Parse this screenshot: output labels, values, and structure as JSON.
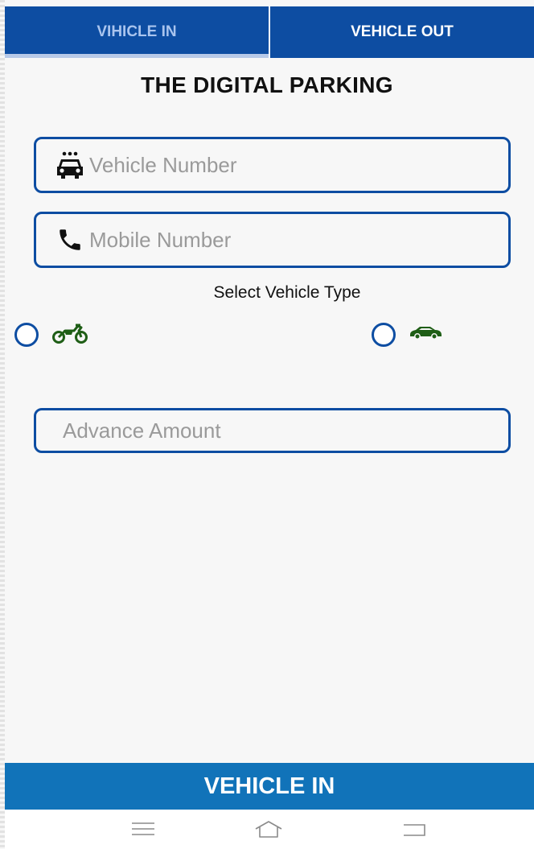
{
  "tabs": [
    {
      "label": "VIHICLE IN",
      "active": true
    },
    {
      "label": "VEHICLE OUT",
      "active": false
    }
  ],
  "title": "THE DIGITAL PARKING",
  "form": {
    "vehicle_number": {
      "placeholder": "Vehicle Number",
      "value": "",
      "icon": "car-front-icon"
    },
    "mobile_number": {
      "placeholder": "Mobile Number",
      "value": "",
      "icon": "phone-icon"
    },
    "select_label": "Select Vehicle Type",
    "vehicle_types": [
      {
        "type": "bike",
        "icon": "motorcycle-icon",
        "selected": false
      },
      {
        "type": "car",
        "icon": "car-icon",
        "selected": false
      }
    ],
    "advance_amount": {
      "placeholder": "Advance Amount",
      "value": ""
    }
  },
  "submit_label": "VEHICLE IN",
  "nav": [
    "menu-icon",
    "home-icon",
    "back-icon"
  ],
  "colors": {
    "primary": "#0d4da2",
    "button": "#1173b9",
    "icon_green": "#1f5e16",
    "background": "#f7f7f7"
  }
}
